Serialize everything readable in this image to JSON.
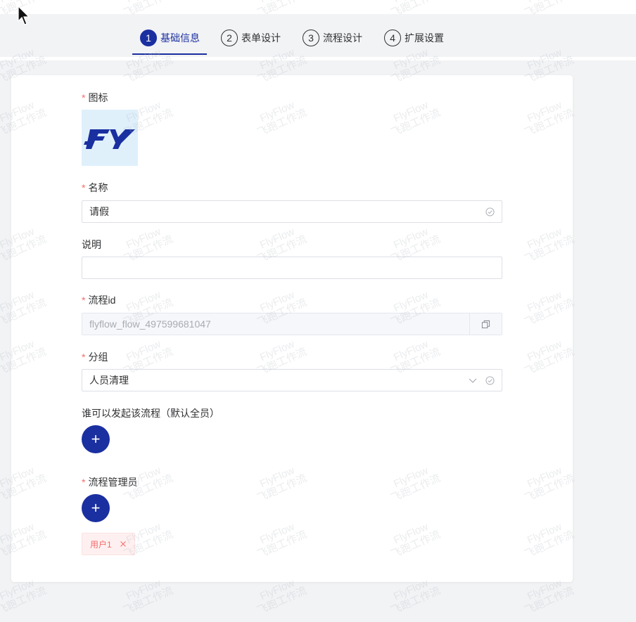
{
  "steps": [
    {
      "num": "1",
      "label": "基础信息",
      "active": true
    },
    {
      "num": "2",
      "label": "表单设计",
      "active": false
    },
    {
      "num": "3",
      "label": "流程设计",
      "active": false
    },
    {
      "num": "4",
      "label": "扩展设置",
      "active": false
    }
  ],
  "form": {
    "icon": {
      "label": "图标",
      "required": true,
      "logo_text": "FY"
    },
    "name": {
      "label": "名称",
      "required": true,
      "value": "请假"
    },
    "description": {
      "label": "说明",
      "required": false,
      "value": ""
    },
    "process_id": {
      "label": "流程id",
      "required": true,
      "value": "flyflow_flow_497599681047"
    },
    "group": {
      "label": "分组",
      "required": true,
      "value": "人员清理"
    },
    "initiators": {
      "label": "谁可以发起该流程（默认全员）",
      "add_label": "+"
    },
    "admins": {
      "label": "流程管理员",
      "required": true,
      "add_label": "+",
      "tags": [
        "用户1"
      ]
    }
  },
  "watermark": {
    "line1": "FlyFlow",
    "line2": "飞跑工作流"
  },
  "colors": {
    "primary": "#1a2fa0",
    "required": "#f56c6c",
    "background": "#f2f3f5"
  }
}
